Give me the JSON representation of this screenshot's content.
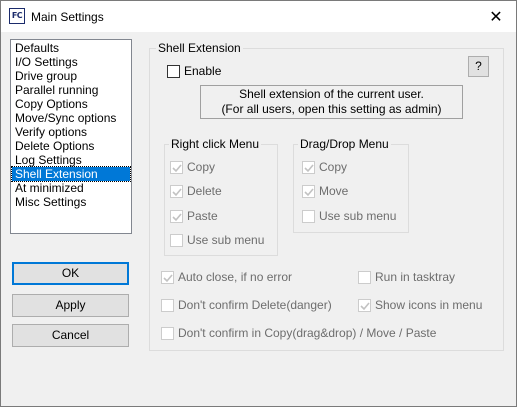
{
  "window": {
    "title": "Main Settings",
    "icon_text": "FC",
    "close_glyph": "✕"
  },
  "sidebar": {
    "items": [
      {
        "label": "Defaults"
      },
      {
        "label": "I/O Settings"
      },
      {
        "label": "Drive group"
      },
      {
        "label": "Parallel running"
      },
      {
        "label": "Copy Options"
      },
      {
        "label": "Move/Sync options"
      },
      {
        "label": "Verify options"
      },
      {
        "label": "Delete Options"
      },
      {
        "label": "Log Settings"
      },
      {
        "label": "Shell Extension",
        "selected": true
      },
      {
        "label": "At minimized"
      },
      {
        "label": "Misc Settings"
      }
    ]
  },
  "buttons": {
    "ok": "OK",
    "apply": "Apply",
    "cancel": "Cancel"
  },
  "shell_extension": {
    "group_title": "Shell Extension",
    "enable_label": "Enable",
    "enable_checked": false,
    "help_label": "?",
    "info_line1": "Shell extension of the current user.",
    "info_line2": "(For all users, open this setting as admin)",
    "right_click_menu": {
      "title": "Right click Menu",
      "copy": "Copy",
      "delete": "Delete",
      "paste": "Paste",
      "use_sub_menu": "Use sub menu"
    },
    "drag_drop_menu": {
      "title": "Drag/Drop Menu",
      "copy": "Copy",
      "move": "Move",
      "use_sub_menu": "Use sub menu"
    },
    "options": {
      "auto_close": "Auto close, if no error",
      "run_in_tasktray": "Run in tasktray",
      "dont_confirm_delete": "Don't confirm Delete(danger)",
      "show_icons_in_menu": "Show icons in menu",
      "dont_confirm_copy": "Don't confirm in Copy(drag&drop) / Move / Paste"
    }
  },
  "colors": {
    "accent": "#0078d7",
    "disabled_text": "#6d6d6d"
  }
}
